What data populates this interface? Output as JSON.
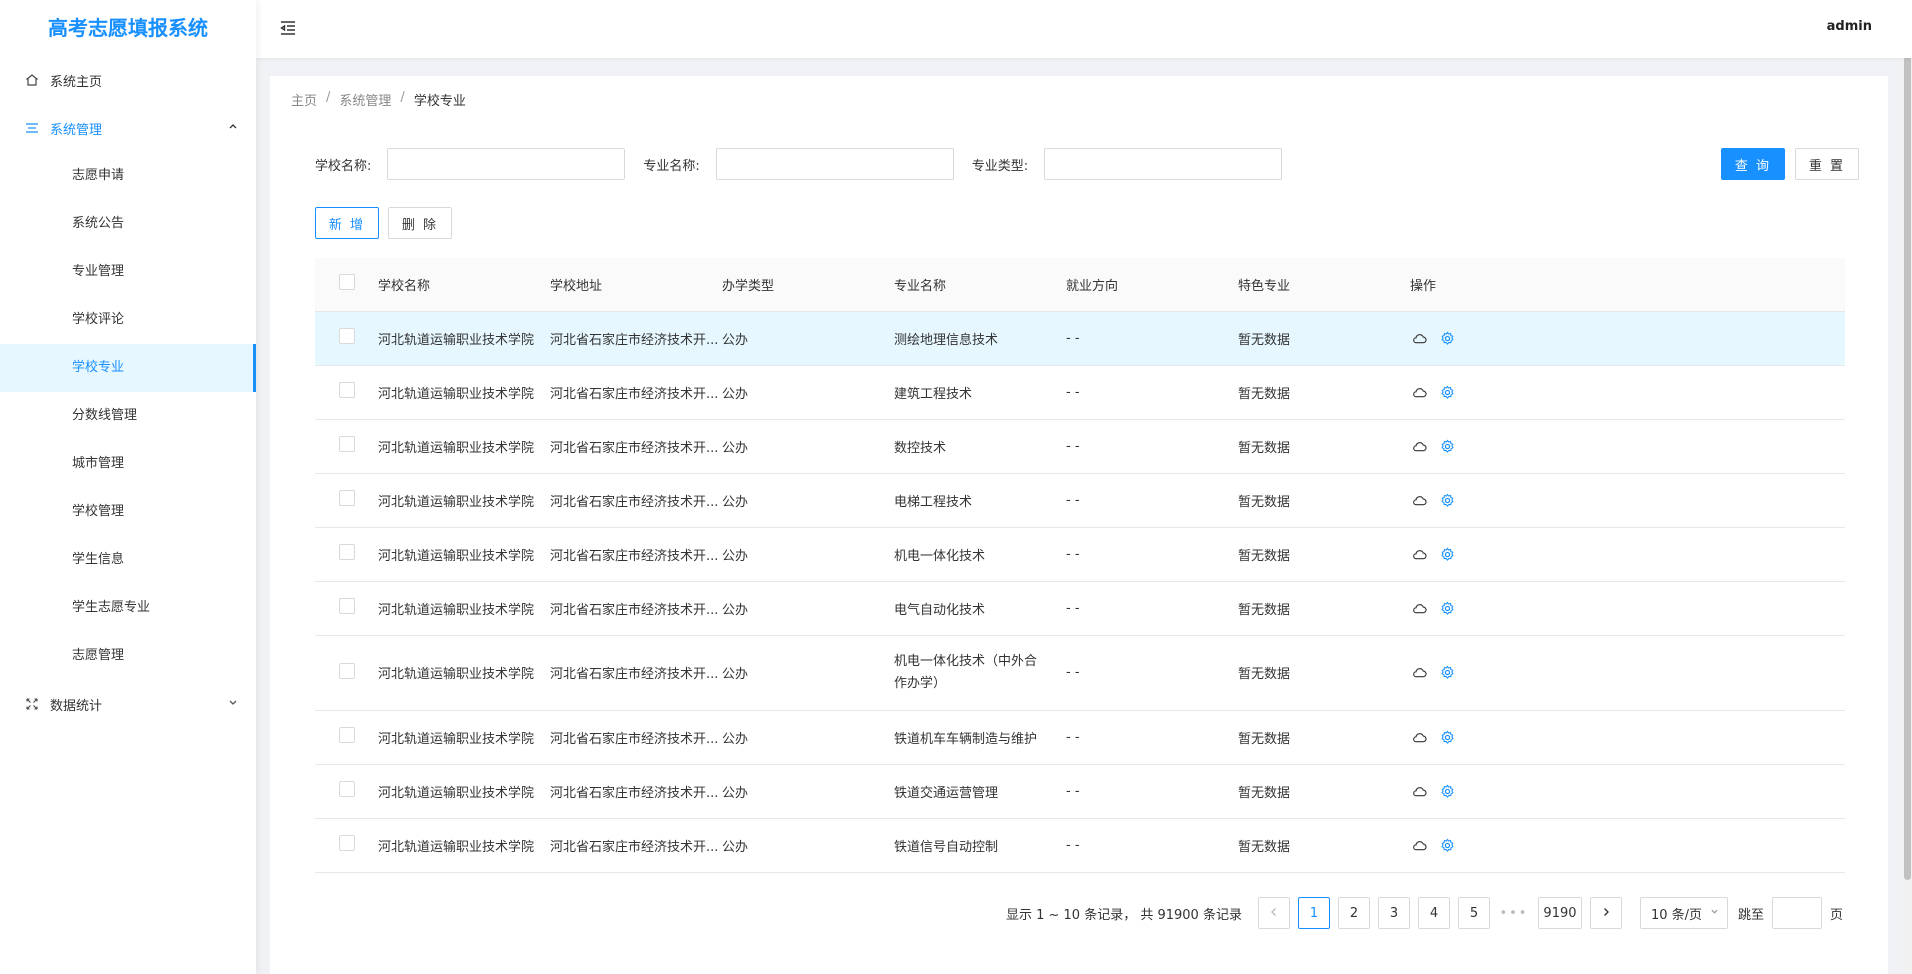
{
  "app": {
    "title": "高考志愿填报系统",
    "user": "admin"
  },
  "sidebar": {
    "home": {
      "label": "系统主页",
      "icon": "home-icon"
    },
    "system": {
      "label": "系统管理",
      "icon": "menu-list-icon",
      "items": [
        {
          "label": "志愿申请"
        },
        {
          "label": "系统公告"
        },
        {
          "label": "专业管理"
        },
        {
          "label": "学校评论"
        },
        {
          "label": "学校专业",
          "active": true
        },
        {
          "label": "分数线管理"
        },
        {
          "label": "城市管理"
        },
        {
          "label": "学校管理"
        },
        {
          "label": "学生信息"
        },
        {
          "label": "学生志愿专业"
        },
        {
          "label": "志愿管理"
        }
      ]
    },
    "stats": {
      "label": "数据统计",
      "icon": "fullscreen-icon"
    }
  },
  "breadcrumb": [
    "主页",
    "系统管理",
    "学校专业"
  ],
  "breadcrumb_sep": "/",
  "search": {
    "school_label": "学校名称:",
    "major_label": "专业名称:",
    "type_label": "专业类型:",
    "school_value": "",
    "major_value": "",
    "type_value": "",
    "query_button": "查 询",
    "reset_button": "重 置"
  },
  "actions": {
    "add_button": "新 增",
    "delete_button": "删 除"
  },
  "table": {
    "headers": [
      "学校名称",
      "学校地址",
      "办学类型",
      "专业名称",
      "就业方向",
      "特色专业",
      "操作"
    ],
    "rows": [
      [
        "河北轨道运输职业技术学院",
        "河北省石家庄市经济技术开...",
        "公办",
        "测绘地理信息技术",
        "- -",
        "暂无数据"
      ],
      [
        "河北轨道运输职业技术学院",
        "河北省石家庄市经济技术开...",
        "公办",
        "建筑工程技术",
        "- -",
        "暂无数据"
      ],
      [
        "河北轨道运输职业技术学院",
        "河北省石家庄市经济技术开...",
        "公办",
        "数控技术",
        "- -",
        "暂无数据"
      ],
      [
        "河北轨道运输职业技术学院",
        "河北省石家庄市经济技术开...",
        "公办",
        "电梯工程技术",
        "- -",
        "暂无数据"
      ],
      [
        "河北轨道运输职业技术学院",
        "河北省石家庄市经济技术开...",
        "公办",
        "机电一体化技术",
        "- -",
        "暂无数据"
      ],
      [
        "河北轨道运输职业技术学院",
        "河北省石家庄市经济技术开...",
        "公办",
        "电气自动化技术",
        "- -",
        "暂无数据"
      ],
      [
        "河北轨道运输职业技术学院",
        "河北省石家庄市经济技术开...",
        "公办",
        "机电一体化技术（中外合作办学）",
        "- -",
        "暂无数据"
      ],
      [
        "河北轨道运输职业技术学院",
        "河北省石家庄市经济技术开...",
        "公办",
        "铁道机车车辆制造与维护",
        "- -",
        "暂无数据"
      ],
      [
        "河北轨道运输职业技术学院",
        "河北省石家庄市经济技术开...",
        "公办",
        "铁道交通运营管理",
        "- -",
        "暂无数据"
      ],
      [
        "河北轨道运输职业技术学院",
        "河北省石家庄市经济技术开...",
        "公办",
        "铁道信号自动控制",
        "- -",
        "暂无数据"
      ]
    ]
  },
  "pagination": {
    "total_text": "显示 1 ~ 10 条记录， 共 91900 条记录",
    "pages": [
      "1",
      "2",
      "3",
      "4",
      "5"
    ],
    "ellipsis": "•••",
    "last_page": "9190",
    "current": "1",
    "page_size": "10 条/页",
    "jump_label": "跳至",
    "page_suffix": "页"
  },
  "colors": {
    "primary": "#1890ff",
    "active_bg": "#e6f7ff",
    "border": "#d9d9d9"
  }
}
